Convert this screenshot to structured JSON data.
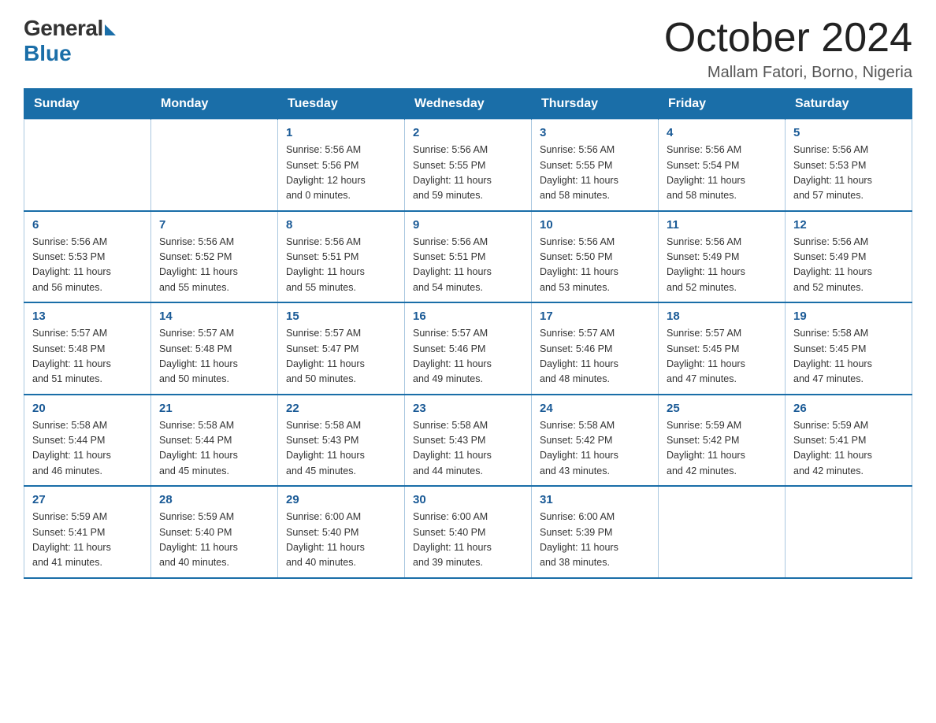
{
  "logo": {
    "general": "General",
    "blue": "Blue"
  },
  "title": "October 2024",
  "location": "Mallam Fatori, Borno, Nigeria",
  "headers": [
    "Sunday",
    "Monday",
    "Tuesday",
    "Wednesday",
    "Thursday",
    "Friday",
    "Saturday"
  ],
  "weeks": [
    [
      {
        "day": "",
        "info": ""
      },
      {
        "day": "",
        "info": ""
      },
      {
        "day": "1",
        "info": "Sunrise: 5:56 AM\nSunset: 5:56 PM\nDaylight: 12 hours\nand 0 minutes."
      },
      {
        "day": "2",
        "info": "Sunrise: 5:56 AM\nSunset: 5:55 PM\nDaylight: 11 hours\nand 59 minutes."
      },
      {
        "day": "3",
        "info": "Sunrise: 5:56 AM\nSunset: 5:55 PM\nDaylight: 11 hours\nand 58 minutes."
      },
      {
        "day": "4",
        "info": "Sunrise: 5:56 AM\nSunset: 5:54 PM\nDaylight: 11 hours\nand 58 minutes."
      },
      {
        "day": "5",
        "info": "Sunrise: 5:56 AM\nSunset: 5:53 PM\nDaylight: 11 hours\nand 57 minutes."
      }
    ],
    [
      {
        "day": "6",
        "info": "Sunrise: 5:56 AM\nSunset: 5:53 PM\nDaylight: 11 hours\nand 56 minutes."
      },
      {
        "day": "7",
        "info": "Sunrise: 5:56 AM\nSunset: 5:52 PM\nDaylight: 11 hours\nand 55 minutes."
      },
      {
        "day": "8",
        "info": "Sunrise: 5:56 AM\nSunset: 5:51 PM\nDaylight: 11 hours\nand 55 minutes."
      },
      {
        "day": "9",
        "info": "Sunrise: 5:56 AM\nSunset: 5:51 PM\nDaylight: 11 hours\nand 54 minutes."
      },
      {
        "day": "10",
        "info": "Sunrise: 5:56 AM\nSunset: 5:50 PM\nDaylight: 11 hours\nand 53 minutes."
      },
      {
        "day": "11",
        "info": "Sunrise: 5:56 AM\nSunset: 5:49 PM\nDaylight: 11 hours\nand 52 minutes."
      },
      {
        "day": "12",
        "info": "Sunrise: 5:56 AM\nSunset: 5:49 PM\nDaylight: 11 hours\nand 52 minutes."
      }
    ],
    [
      {
        "day": "13",
        "info": "Sunrise: 5:57 AM\nSunset: 5:48 PM\nDaylight: 11 hours\nand 51 minutes."
      },
      {
        "day": "14",
        "info": "Sunrise: 5:57 AM\nSunset: 5:48 PM\nDaylight: 11 hours\nand 50 minutes."
      },
      {
        "day": "15",
        "info": "Sunrise: 5:57 AM\nSunset: 5:47 PM\nDaylight: 11 hours\nand 50 minutes."
      },
      {
        "day": "16",
        "info": "Sunrise: 5:57 AM\nSunset: 5:46 PM\nDaylight: 11 hours\nand 49 minutes."
      },
      {
        "day": "17",
        "info": "Sunrise: 5:57 AM\nSunset: 5:46 PM\nDaylight: 11 hours\nand 48 minutes."
      },
      {
        "day": "18",
        "info": "Sunrise: 5:57 AM\nSunset: 5:45 PM\nDaylight: 11 hours\nand 47 minutes."
      },
      {
        "day": "19",
        "info": "Sunrise: 5:58 AM\nSunset: 5:45 PM\nDaylight: 11 hours\nand 47 minutes."
      }
    ],
    [
      {
        "day": "20",
        "info": "Sunrise: 5:58 AM\nSunset: 5:44 PM\nDaylight: 11 hours\nand 46 minutes."
      },
      {
        "day": "21",
        "info": "Sunrise: 5:58 AM\nSunset: 5:44 PM\nDaylight: 11 hours\nand 45 minutes."
      },
      {
        "day": "22",
        "info": "Sunrise: 5:58 AM\nSunset: 5:43 PM\nDaylight: 11 hours\nand 45 minutes."
      },
      {
        "day": "23",
        "info": "Sunrise: 5:58 AM\nSunset: 5:43 PM\nDaylight: 11 hours\nand 44 minutes."
      },
      {
        "day": "24",
        "info": "Sunrise: 5:58 AM\nSunset: 5:42 PM\nDaylight: 11 hours\nand 43 minutes."
      },
      {
        "day": "25",
        "info": "Sunrise: 5:59 AM\nSunset: 5:42 PM\nDaylight: 11 hours\nand 42 minutes."
      },
      {
        "day": "26",
        "info": "Sunrise: 5:59 AM\nSunset: 5:41 PM\nDaylight: 11 hours\nand 42 minutes."
      }
    ],
    [
      {
        "day": "27",
        "info": "Sunrise: 5:59 AM\nSunset: 5:41 PM\nDaylight: 11 hours\nand 41 minutes."
      },
      {
        "day": "28",
        "info": "Sunrise: 5:59 AM\nSunset: 5:40 PM\nDaylight: 11 hours\nand 40 minutes."
      },
      {
        "day": "29",
        "info": "Sunrise: 6:00 AM\nSunset: 5:40 PM\nDaylight: 11 hours\nand 40 minutes."
      },
      {
        "day": "30",
        "info": "Sunrise: 6:00 AM\nSunset: 5:40 PM\nDaylight: 11 hours\nand 39 minutes."
      },
      {
        "day": "31",
        "info": "Sunrise: 6:00 AM\nSunset: 5:39 PM\nDaylight: 11 hours\nand 38 minutes."
      },
      {
        "day": "",
        "info": ""
      },
      {
        "day": "",
        "info": ""
      }
    ]
  ]
}
